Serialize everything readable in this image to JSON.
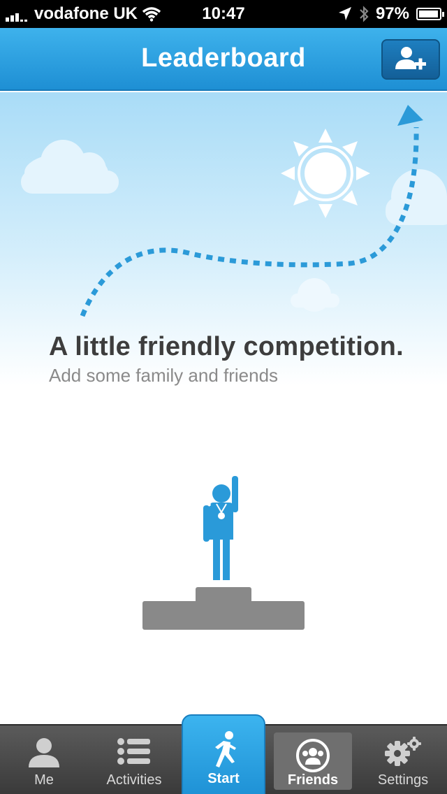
{
  "status_bar": {
    "carrier": "vodafone UK",
    "time": "10:47",
    "battery": "97%",
    "battery_level": 0.97
  },
  "nav": {
    "title": "Leaderboard",
    "add_friend_icon": "add-person-icon"
  },
  "empty_state": {
    "headline": "A little friendly competition.",
    "subline": "Add some family and friends"
  },
  "tabs": [
    {
      "label": "Me",
      "icon": "person-icon"
    },
    {
      "label": "Activities",
      "icon": "list-icon"
    },
    {
      "label": "Start",
      "icon": "runner-icon"
    },
    {
      "label": "Friends",
      "icon": "friends-icon"
    },
    {
      "label": "Settings",
      "icon": "gear-icon"
    }
  ],
  "colors": {
    "accent": "#1e8fd4",
    "sky": "#a9dcf7",
    "figure": "#2a9ad9",
    "podium": "#898989",
    "tab_bar": "#4a4a4a"
  }
}
